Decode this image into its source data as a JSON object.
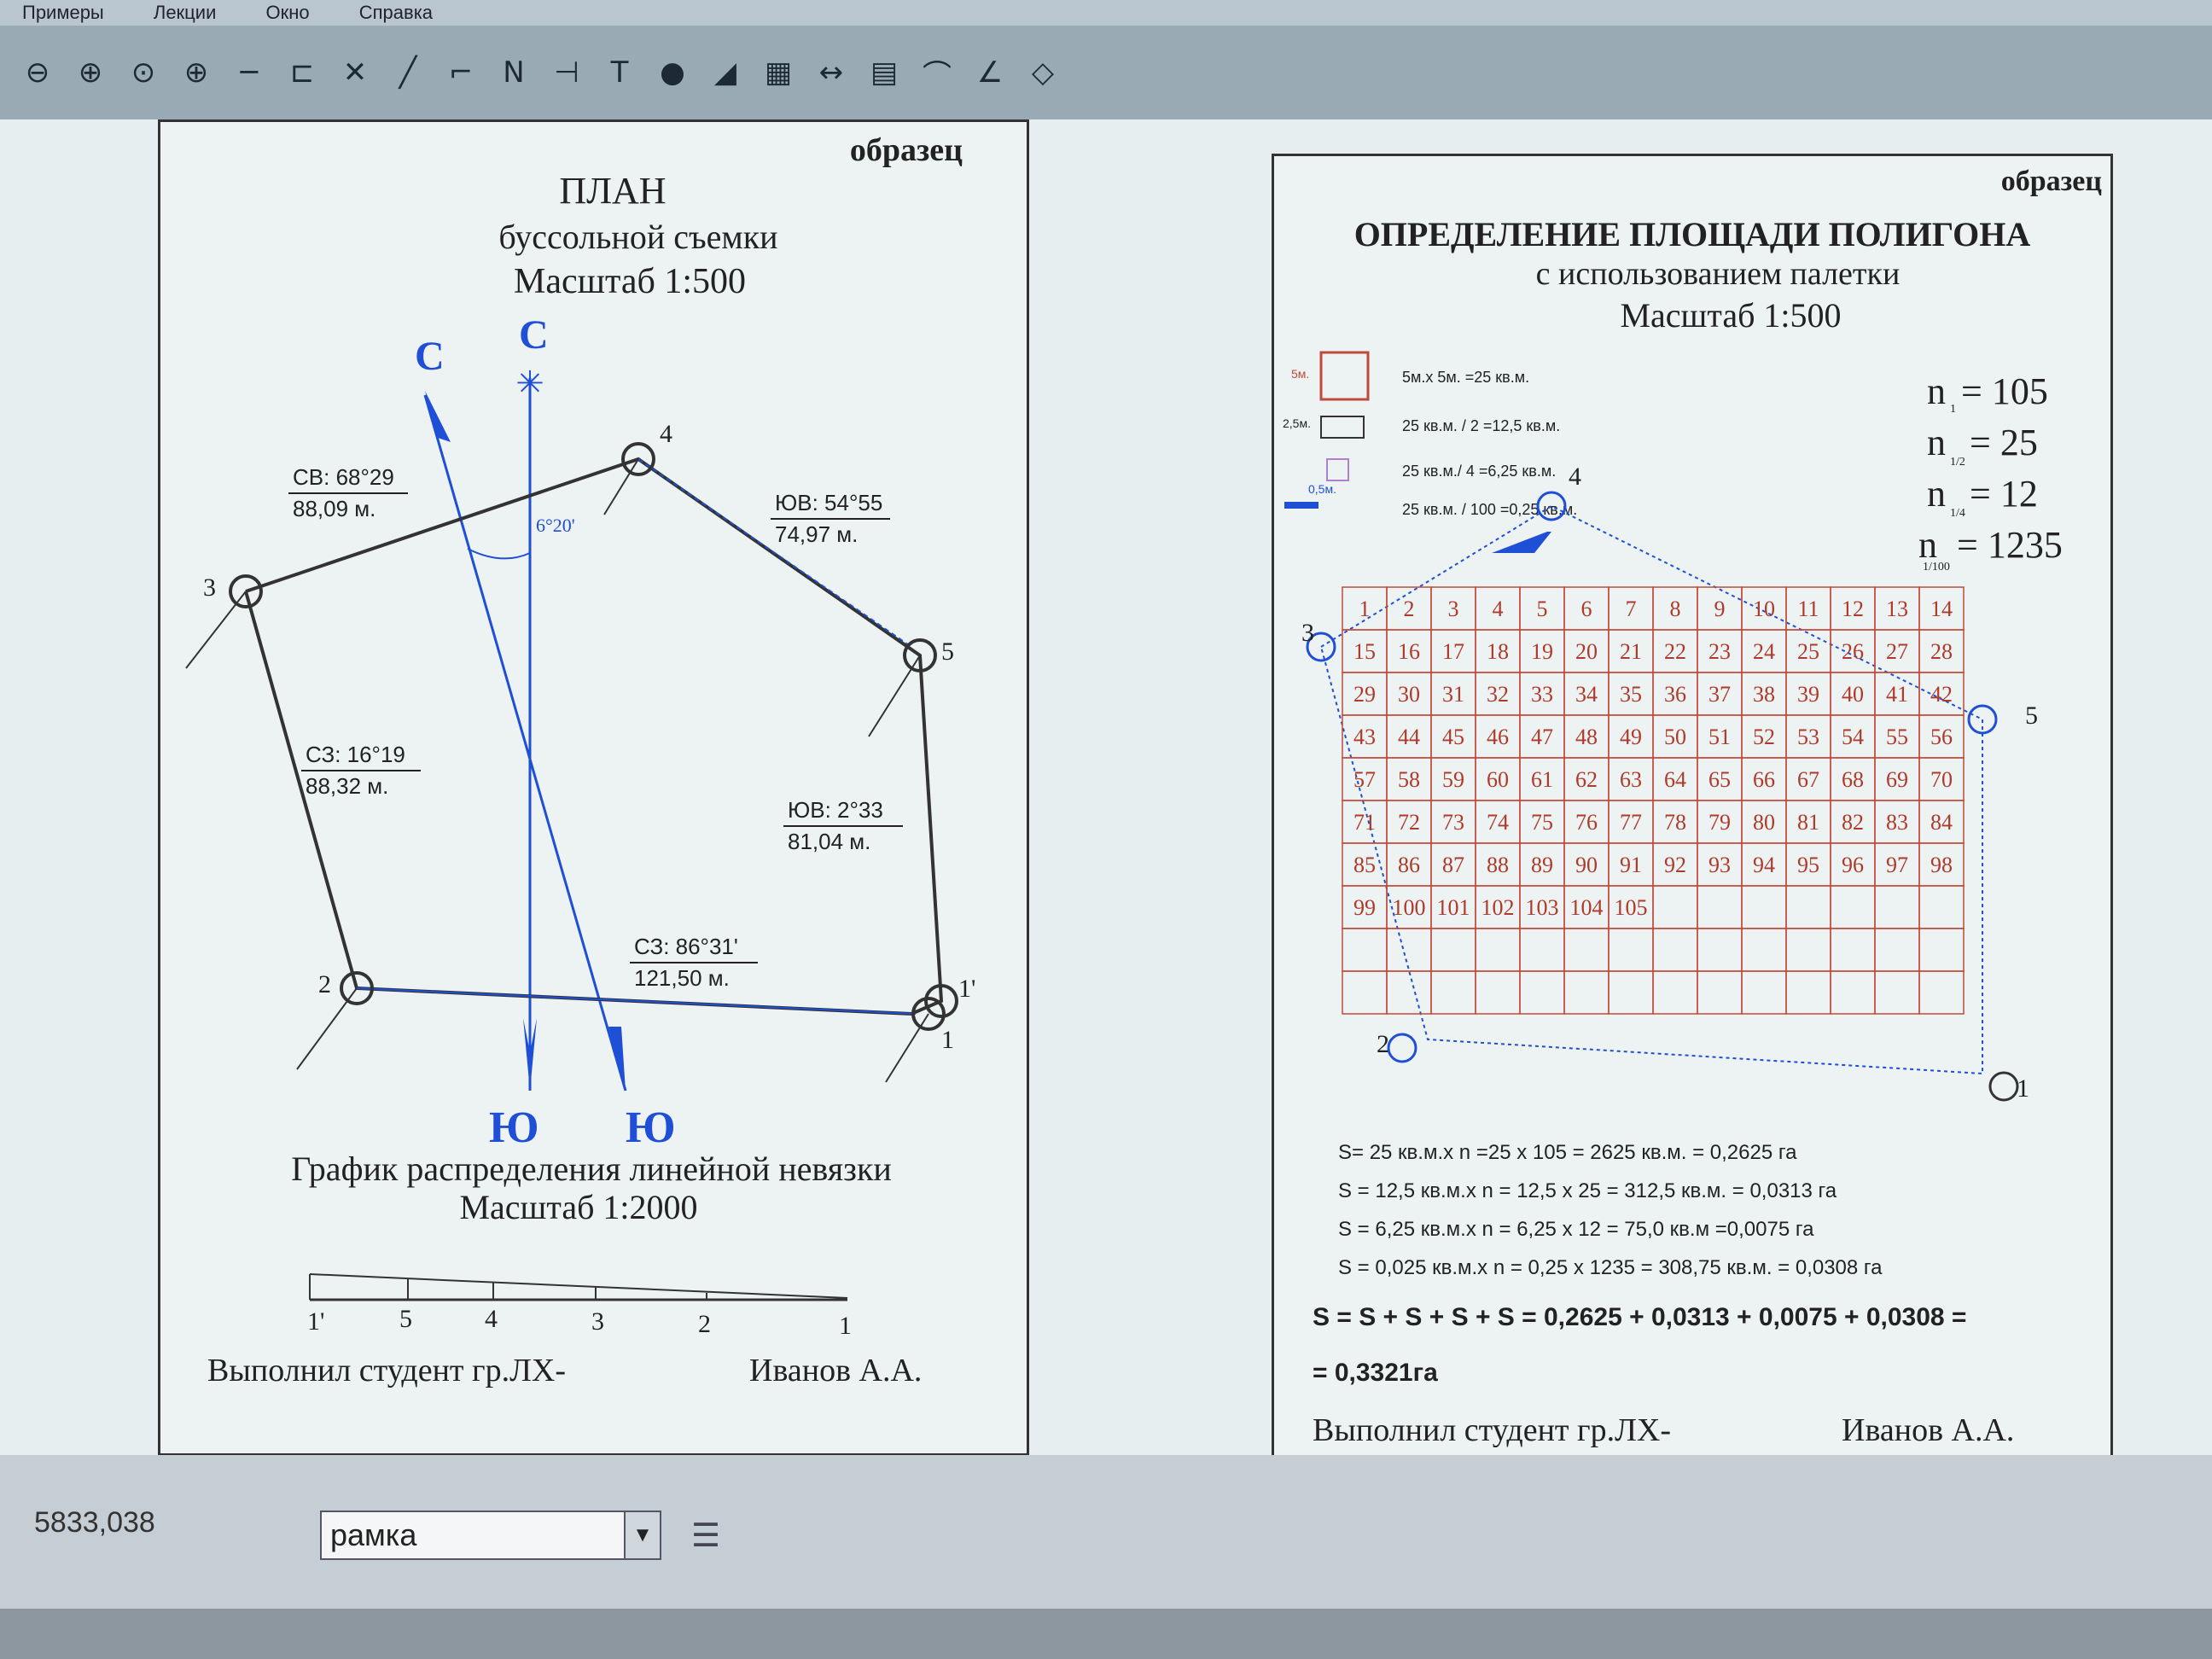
{
  "menu": [
    "Примеры",
    "Лекции",
    "Окно",
    "Справка"
  ],
  "toolbar_icons": [
    "zoom-out-icon",
    "zoom-in-icon",
    "zoom-window-icon",
    "crosshair-icon",
    "line-icon",
    "frame-icon",
    "delete-icon",
    "pen-icon",
    "polyline-icon",
    "north-icon",
    "snap-icon",
    "text-icon",
    "circle-icon",
    "fill-icon",
    "grid-icon"
  ],
  "left_sheet": {
    "sample": "образец",
    "title1": "ПЛАН",
    "title2": "буссольной съемки",
    "scale": "Масштаб 1:500",
    "north1": "С",
    "north2": "С",
    "south1": "Ю",
    "south2": "Ю",
    "angle": "6°20'",
    "bearings": [
      {
        "dir": "СВ: 68°29",
        "dist": "88,09 м."
      },
      {
        "dir": "ЮВ: 54°55",
        "dist": "74,97 м."
      },
      {
        "dir": "СЗ: 16°19",
        "dist": "88,32 м."
      },
      {
        "dir": "ЮВ: 2°33",
        "dist": "81,04 м."
      },
      {
        "dir": "СЗ: 86°31'",
        "dist": "121,50 м."
      }
    ],
    "points": [
      "1",
      "1'",
      "2",
      "3",
      "4",
      "5"
    ],
    "graph_title": "График распределения линейной невязки",
    "graph_scale": "Масштаб 1:2000",
    "graph_ticks": [
      "1'",
      "5",
      "4",
      "3",
      "2",
      "1"
    ],
    "footer_left": "Выполнил студент гр.ЛХ-",
    "footer_right": "Иванов А.А."
  },
  "right_sheet": {
    "sample": "образец",
    "title1": "ОПРЕДЕЛЕНИЕ ПЛОЩАДИ ПОЛИГОНА",
    "title2": "с использованием палетки",
    "scale": "Масштаб 1:500",
    "legend": [
      "5м.х 5м. =25 кв.м.",
      "25 кв.м. / 2 =12,5 кв.м.",
      "25 кв.м./ 4 =6,25 кв.м.",
      "25 кв.м. / 100 =0,25 кв.м."
    ],
    "legend_marks": [
      "5м.",
      "2,5м.",
      "0,5м."
    ],
    "counts": [
      {
        "label": "n",
        "sub": "1",
        "value": "= 105"
      },
      {
        "label": "n",
        "sub": "1/2",
        "value": "= 25"
      },
      {
        "label": "n",
        "sub": "1/4",
        "value": "= 12"
      },
      {
        "label": "n",
        "sub": "1/100",
        "value": "= 1235"
      }
    ],
    "points": [
      "1",
      "2",
      "3",
      "4",
      "5"
    ],
    "formulas": [
      "S= 25 кв.м.х n =25 х 105 = 2625 кв.м. = 0,2625 га",
      "S  = 12,5 кв.м.х n = 12,5 х 25 = 312,5 кв.м. = 0,0313 га",
      "S  = 6,25 кв.м.х n = 6,25 х 12 = 75,0 кв.м =0,0075 га",
      "S   = 0,025 кв.м.х n  = 0,25 х 1235 = 308,75 кв.м. = 0,0308 га"
    ],
    "total1": "S = S + S + S + S = 0,2625 + 0,0313 + 0,0075 + 0,0308 =",
    "total2": "= 0,3321га",
    "footer_left": "Выполнил студент гр.ЛХ-",
    "footer_right": "Иванов А.А."
  },
  "status": {
    "coordinate": "5833,038",
    "layer": "рамка"
  },
  "colors": {
    "accent_blue": "#1f4fd6",
    "grid_red": "#c04a3a",
    "line": "#333333"
  }
}
